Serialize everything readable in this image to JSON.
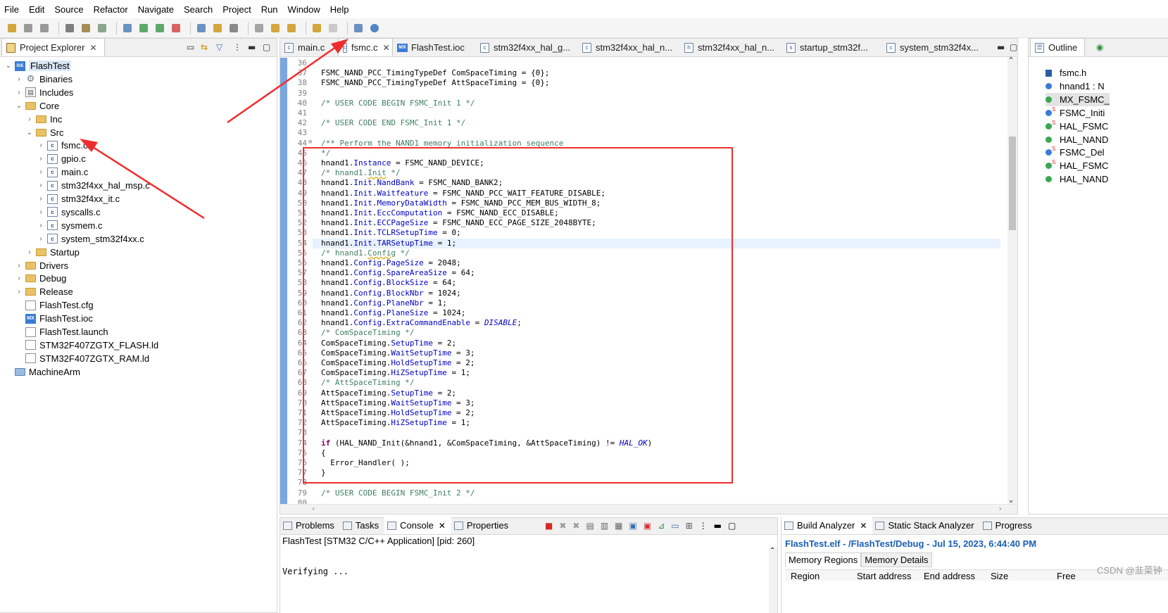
{
  "menu": [
    "File",
    "Edit",
    "Source",
    "Refactor",
    "Navigate",
    "Search",
    "Project",
    "Run",
    "Window",
    "Help"
  ],
  "project_explorer": {
    "title": "Project Explorer",
    "tree": [
      {
        "label": "FlashTest",
        "icon": "ide-project-icon",
        "level": 0,
        "state": "expanded"
      },
      {
        "label": "Binaries",
        "icon": "binaries-icon",
        "level": 1,
        "state": "collapsed"
      },
      {
        "label": "Includes",
        "icon": "includes-icon",
        "level": 1,
        "state": "collapsed"
      },
      {
        "label": "Core",
        "icon": "folder-icon",
        "level": 1,
        "state": "expanded"
      },
      {
        "label": "Inc",
        "icon": "folder-icon",
        "level": 2,
        "state": "collapsed"
      },
      {
        "label": "Src",
        "icon": "folder-icon",
        "level": 2,
        "state": "expanded"
      },
      {
        "label": "fsmc.c",
        "icon": "c-file-icon",
        "level": 3,
        "state": "collapsed"
      },
      {
        "label": "gpio.c",
        "icon": "c-file-icon",
        "level": 3,
        "state": "collapsed"
      },
      {
        "label": "main.c",
        "icon": "c-file-icon",
        "level": 3,
        "state": "collapsed"
      },
      {
        "label": "stm32f4xx_hal_msp.c",
        "icon": "c-file-icon",
        "level": 3,
        "state": "collapsed"
      },
      {
        "label": "stm32f4xx_it.c",
        "icon": "c-file-icon",
        "level": 3,
        "state": "collapsed"
      },
      {
        "label": "syscalls.c",
        "icon": "c-file-icon",
        "level": 3,
        "state": "collapsed"
      },
      {
        "label": "sysmem.c",
        "icon": "c-file-icon",
        "level": 3,
        "state": "collapsed"
      },
      {
        "label": "system_stm32f4xx.c",
        "icon": "c-file-icon",
        "level": 3,
        "state": "collapsed"
      },
      {
        "label": "Startup",
        "icon": "folder-icon",
        "level": 2,
        "state": "collapsed"
      },
      {
        "label": "Drivers",
        "icon": "folder-icon",
        "level": 1,
        "state": "collapsed"
      },
      {
        "label": "Debug",
        "icon": "folder-icon",
        "level": 1,
        "state": "collapsed"
      },
      {
        "label": "Release",
        "icon": "folder-icon",
        "level": 1,
        "state": "collapsed"
      },
      {
        "label": "FlashTest.cfg",
        "icon": "file-icon",
        "level": 1,
        "state": "leaf"
      },
      {
        "label": "FlashTest.ioc",
        "icon": "mx-file-icon",
        "level": 1,
        "state": "leaf"
      },
      {
        "label": "FlashTest.launch",
        "icon": "file-icon",
        "level": 1,
        "state": "leaf"
      },
      {
        "label": "STM32F407ZGTX_FLASH.ld",
        "icon": "ld-file-icon",
        "level": 1,
        "state": "leaf"
      },
      {
        "label": "STM32F407ZGTX_RAM.ld",
        "icon": "ld-file-icon",
        "level": 1,
        "state": "leaf"
      },
      {
        "label": "MachineArm",
        "icon": "project-folder-icon",
        "level": 0,
        "state": "leaf"
      }
    ]
  },
  "editor": {
    "tabs": [
      {
        "label": "main.c",
        "icon": "c"
      },
      {
        "label": "fsmc.c",
        "icon": "c",
        "active": true
      },
      {
        "label": "FlashTest.ioc",
        "icon": "mx"
      },
      {
        "label": "stm32f4xx_hal_g...",
        "icon": "c"
      },
      {
        "label": "stm32f4xx_hal_n...",
        "icon": "c"
      },
      {
        "label": "stm32f4xx_hal_n...",
        "icon": "h"
      },
      {
        "label": "startup_stm32f...",
        "icon": "s"
      },
      {
        "label": "system_stm32f4x...",
        "icon": "c"
      }
    ],
    "current_line": 54,
    "lines": [
      {
        "n": "36",
        "t": []
      },
      {
        "n": "37",
        "t": [
          {
            "c": "",
            "s": "FSMC_NAND_PCC_TimingTypeDef ComSpaceTiming = {0};"
          }
        ]
      },
      {
        "n": "38",
        "t": [
          {
            "c": "",
            "s": "FSMC_NAND_PCC_TimingTypeDef AttSpaceTiming = {0};"
          }
        ]
      },
      {
        "n": "39",
        "t": []
      },
      {
        "n": "40",
        "t": [
          {
            "c": "cmt",
            "s": "/* USER CODE BEGIN FSMC_Init 1 */"
          }
        ]
      },
      {
        "n": "41",
        "t": []
      },
      {
        "n": "42",
        "t": [
          {
            "c": "cmt",
            "s": "/* USER CODE END FSMC_Init 1 */"
          }
        ]
      },
      {
        "n": "43",
        "t": []
      },
      {
        "n": "44",
        "fold": "⊖",
        "t": [
          {
            "c": "cmt",
            "s": "/** Perform the NAND1 memory initialization sequence"
          }
        ]
      },
      {
        "n": "45",
        "t": [
          {
            "c": "cmt",
            "s": "*/"
          }
        ]
      },
      {
        "n": "46",
        "t": [
          {
            "c": "",
            "s": "hnand1."
          },
          {
            "c": "fld",
            "s": "Instance"
          },
          {
            "c": "",
            "s": " = FSMC_NAND_DEVICE;"
          }
        ]
      },
      {
        "n": "47",
        "t": [
          {
            "c": "cmt",
            "s": "/* hnand1."
          },
          {
            "c": "cmt squig",
            "s": "Init"
          },
          {
            "c": "cmt",
            "s": " */"
          }
        ]
      },
      {
        "n": "48",
        "t": [
          {
            "c": "",
            "s": "hnand1."
          },
          {
            "c": "fld",
            "s": "Init"
          },
          {
            "c": "",
            "s": "."
          },
          {
            "c": "fld",
            "s": "NandBank"
          },
          {
            "c": "",
            "s": " = FSMC_NAND_BANK2;"
          }
        ]
      },
      {
        "n": "49",
        "t": [
          {
            "c": "",
            "s": "hnand1."
          },
          {
            "c": "fld",
            "s": "Init"
          },
          {
            "c": "",
            "s": "."
          },
          {
            "c": "fld",
            "s": "Waitfeature"
          },
          {
            "c": "",
            "s": " = FSMC_NAND_PCC_WAIT_FEATURE_DISABLE;"
          }
        ]
      },
      {
        "n": "50",
        "t": [
          {
            "c": "",
            "s": "hnand1."
          },
          {
            "c": "fld",
            "s": "Init"
          },
          {
            "c": "",
            "s": "."
          },
          {
            "c": "fld",
            "s": "MemoryDataWidth"
          },
          {
            "c": "",
            "s": " = FSMC_NAND_PCC_MEM_BUS_WIDTH_8;"
          }
        ]
      },
      {
        "n": "51",
        "t": [
          {
            "c": "",
            "s": "hnand1."
          },
          {
            "c": "fld",
            "s": "Init"
          },
          {
            "c": "",
            "s": "."
          },
          {
            "c": "fld",
            "s": "EccComputation"
          },
          {
            "c": "",
            "s": " = FSMC_NAND_ECC_DISABLE;"
          }
        ]
      },
      {
        "n": "52",
        "t": [
          {
            "c": "",
            "s": "hnand1."
          },
          {
            "c": "fld",
            "s": "Init"
          },
          {
            "c": "",
            "s": "."
          },
          {
            "c": "fld",
            "s": "ECCPageSize"
          },
          {
            "c": "",
            "s": " = FSMC_NAND_ECC_PAGE_SIZE_2048BYTE;"
          }
        ]
      },
      {
        "n": "53",
        "t": [
          {
            "c": "",
            "s": "hnand1."
          },
          {
            "c": "fld",
            "s": "Init"
          },
          {
            "c": "",
            "s": "."
          },
          {
            "c": "fld",
            "s": "TCLRSetupTime"
          },
          {
            "c": "",
            "s": " = 0;"
          }
        ]
      },
      {
        "n": "54",
        "t": [
          {
            "c": "",
            "s": "hnand1."
          },
          {
            "c": "fld",
            "s": "Init"
          },
          {
            "c": "",
            "s": "."
          },
          {
            "c": "fld",
            "s": "TARSetupTime"
          },
          {
            "c": "",
            "s": " = 1;"
          }
        ]
      },
      {
        "n": "55",
        "t": [
          {
            "c": "cmt",
            "s": "/* hnand1."
          },
          {
            "c": "cmt squig",
            "s": "Config"
          },
          {
            "c": "cmt",
            "s": " */"
          }
        ]
      },
      {
        "n": "56",
        "t": [
          {
            "c": "",
            "s": "hnand1."
          },
          {
            "c": "fld",
            "s": "Config"
          },
          {
            "c": "",
            "s": "."
          },
          {
            "c": "fld",
            "s": "PageSize"
          },
          {
            "c": "",
            "s": " = 2048;"
          }
        ]
      },
      {
        "n": "57",
        "t": [
          {
            "c": "",
            "s": "hnand1."
          },
          {
            "c": "fld",
            "s": "Config"
          },
          {
            "c": "",
            "s": "."
          },
          {
            "c": "fld",
            "s": "SpareAreaSize"
          },
          {
            "c": "",
            "s": " = 64;"
          }
        ]
      },
      {
        "n": "58",
        "t": [
          {
            "c": "",
            "s": "hnand1."
          },
          {
            "c": "fld",
            "s": "Config"
          },
          {
            "c": "",
            "s": "."
          },
          {
            "c": "fld",
            "s": "BlockSize"
          },
          {
            "c": "",
            "s": " = 64;"
          }
        ]
      },
      {
        "n": "59",
        "t": [
          {
            "c": "",
            "s": "hnand1."
          },
          {
            "c": "fld",
            "s": "Config"
          },
          {
            "c": "",
            "s": "."
          },
          {
            "c": "fld",
            "s": "BlockNbr"
          },
          {
            "c": "",
            "s": " = 1024;"
          }
        ]
      },
      {
        "n": "60",
        "t": [
          {
            "c": "",
            "s": "hnand1."
          },
          {
            "c": "fld",
            "s": "Config"
          },
          {
            "c": "",
            "s": "."
          },
          {
            "c": "fld",
            "s": "PlaneNbr"
          },
          {
            "c": "",
            "s": " = 1;"
          }
        ]
      },
      {
        "n": "61",
        "t": [
          {
            "c": "",
            "s": "hnand1."
          },
          {
            "c": "fld",
            "s": "Config"
          },
          {
            "c": "",
            "s": "."
          },
          {
            "c": "fld",
            "s": "PlaneSize"
          },
          {
            "c": "",
            "s": " = 1024;"
          }
        ]
      },
      {
        "n": "62",
        "t": [
          {
            "c": "",
            "s": "hnand1."
          },
          {
            "c": "fld",
            "s": "Config"
          },
          {
            "c": "",
            "s": "."
          },
          {
            "c": "fld",
            "s": "ExtraCommandEnable"
          },
          {
            "c": "",
            "s": " = "
          },
          {
            "c": "en",
            "s": "DISABLE"
          },
          {
            "c": "",
            "s": ";"
          }
        ]
      },
      {
        "n": "63",
        "t": [
          {
            "c": "cmt",
            "s": "/* ComSpaceTiming */"
          }
        ]
      },
      {
        "n": "64",
        "t": [
          {
            "c": "",
            "s": "ComSpaceTiming."
          },
          {
            "c": "fld",
            "s": "SetupTime"
          },
          {
            "c": "",
            "s": " = 2;"
          }
        ]
      },
      {
        "n": "65",
        "t": [
          {
            "c": "",
            "s": "ComSpaceTiming."
          },
          {
            "c": "fld",
            "s": "WaitSetupTime"
          },
          {
            "c": "",
            "s": " = 3;"
          }
        ]
      },
      {
        "n": "66",
        "t": [
          {
            "c": "",
            "s": "ComSpaceTiming."
          },
          {
            "c": "fld",
            "s": "HoldSetupTime"
          },
          {
            "c": "",
            "s": " = 2;"
          }
        ]
      },
      {
        "n": "67",
        "t": [
          {
            "c": "",
            "s": "ComSpaceTiming."
          },
          {
            "c": "fld",
            "s": "HiZSetupTime"
          },
          {
            "c": "",
            "s": " = 1;"
          }
        ]
      },
      {
        "n": "68",
        "t": [
          {
            "c": "cmt",
            "s": "/* AttSpaceTiming */"
          }
        ]
      },
      {
        "n": "69",
        "t": [
          {
            "c": "",
            "s": "AttSpaceTiming."
          },
          {
            "c": "fld",
            "s": "SetupTime"
          },
          {
            "c": "",
            "s": " = 2;"
          }
        ]
      },
      {
        "n": "70",
        "t": [
          {
            "c": "",
            "s": "AttSpaceTiming."
          },
          {
            "c": "fld",
            "s": "WaitSetupTime"
          },
          {
            "c": "",
            "s": " = 3;"
          }
        ]
      },
      {
        "n": "71",
        "t": [
          {
            "c": "",
            "s": "AttSpaceTiming."
          },
          {
            "c": "fld",
            "s": "HoldSetupTime"
          },
          {
            "c": "",
            "s": " = 2;"
          }
        ]
      },
      {
        "n": "72",
        "t": [
          {
            "c": "",
            "s": "AttSpaceTiming."
          },
          {
            "c": "fld",
            "s": "HiZSetupTime"
          },
          {
            "c": "",
            "s": " = 1;"
          }
        ]
      },
      {
        "n": "73",
        "t": []
      },
      {
        "n": "74",
        "t": [
          {
            "c": "kw",
            "s": "if"
          },
          {
            "c": "",
            "s": " (HAL_NAND_Init(&hnand1, &ComSpaceTiming, &AttSpaceTiming) != "
          },
          {
            "c": "en",
            "s": "HAL_OK"
          },
          {
            "c": "",
            "s": ")"
          }
        ]
      },
      {
        "n": "75",
        "t": [
          {
            "c": "",
            "s": "{"
          }
        ]
      },
      {
        "n": "76",
        "t": [
          {
            "c": "",
            "s": "  Error_Handler( );"
          }
        ]
      },
      {
        "n": "77",
        "t": [
          {
            "c": "",
            "s": "}"
          }
        ]
      },
      {
        "n": "78",
        "t": []
      },
      {
        "n": "79",
        "t": [
          {
            "c": "cmt",
            "s": "/* USER CODE BEGIN FSMC_Init 2 */"
          }
        ]
      },
      {
        "n": "80",
        "t": []
      }
    ]
  },
  "outline": {
    "title": "Outline",
    "items": [
      {
        "label": "fsmc.h",
        "icon": "header-include-icon",
        "color": "#2b5fa5"
      },
      {
        "label": "hnand1 : N",
        "icon": "variable-icon",
        "color": "#3a7bd5"
      },
      {
        "label": "MX_FSMC_",
        "icon": "function-icon",
        "color": "#3aa655",
        "selected": true
      },
      {
        "label": "FSMC_Initi",
        "icon": "static-variable-icon",
        "color": "#3a7bd5",
        "static": true
      },
      {
        "label": "HAL_FSMC",
        "icon": "static-function-icon",
        "color": "#3aa655",
        "static": true
      },
      {
        "label": "HAL_NAND",
        "icon": "function-icon",
        "color": "#3aa655"
      },
      {
        "label": "FSMC_Del",
        "icon": "static-variable-icon",
        "color": "#3a7bd5",
        "static": true
      },
      {
        "label": "HAL_FSMC",
        "icon": "static-function-icon",
        "color": "#3aa655",
        "static": true
      },
      {
        "label": "HAL_NAND",
        "icon": "function-icon",
        "color": "#3aa655"
      }
    ]
  },
  "console": {
    "tabs": [
      "Problems",
      "Tasks",
      "Console",
      "Properties"
    ],
    "active": "Console",
    "header": "FlashTest [STM32 C/C++ Application]  [pid: 260]",
    "output": "Verifying ..."
  },
  "build_analyzer": {
    "tabs": [
      "Build Analyzer",
      "Static Stack Analyzer",
      "Progress"
    ],
    "file_line": "FlashTest.elf - /FlashTest/Debug - Jul 15, 2023, 6:44:40 PM",
    "subtabs": [
      "Memory Regions",
      "Memory Details"
    ],
    "columns": [
      "Region",
      "Start address",
      "End address",
      "Size",
      "Free"
    ]
  },
  "watermark": "CSDN @韭菜钟",
  "colors": {
    "annotation": "#ee2e2e",
    "code_comment": "#3f7f5f",
    "code_field": "#0000c0",
    "code_keyword": "#7f0055",
    "link_blue": "#1a5fb4"
  }
}
